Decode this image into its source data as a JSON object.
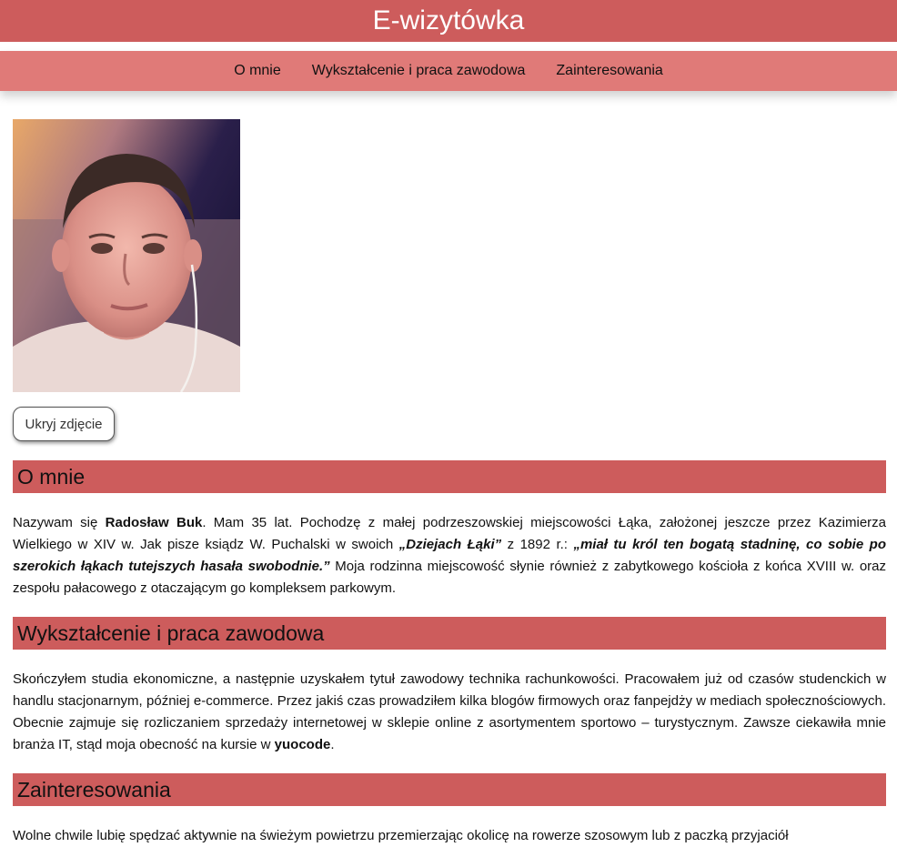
{
  "header": {
    "title": "E-wizytówka"
  },
  "nav": {
    "items": [
      {
        "label": "O mnie"
      },
      {
        "label": "Wykształcenie i praca zawodowa"
      },
      {
        "label": "Zainteresowania"
      }
    ]
  },
  "photo": {
    "button_label": "Ukryj zdjęcie"
  },
  "sections": {
    "about": {
      "heading": "O mnie",
      "p_intro": "Nazywam się ",
      "name": "Radosław Buk",
      "p_mid1": ". Mam 35 lat. Pochodzę z małej podrzeszowskiej miejscowości Łąka, założonej jeszcze przez Kazimierza Wielkiego w XIV w. Jak pisze ksiądz W. Puchalski w swoich ",
      "book": "„Dziejach Łąki”",
      "p_mid2": " z 1892 r.: ",
      "quote": "„miał tu król ten bogatą stadninę, co sobie po szerokich łąkach tutejszych hasała swobodnie.”",
      "p_end": " Moja rodzinna miejscowość słynie również z zabytkowego kościoła z końca XVIII w. oraz zespołu pałacowego z otaczającym go kompleksem parkowym."
    },
    "education": {
      "heading": "Wykształcenie i praca zawodowa",
      "p_text": "Skończyłem studia ekonomiczne, a następnie uzyskałem tytuł zawodowy technika rachunkowości. Pracowałem już od czasów studenckich w handlu stacjonarnym, później e-commerce. Przez jakiś czas prowadziłem kilka blogów firmowych oraz fanpejdży w mediach społecznościowych. Obecnie zajmuje się rozliczaniem sprzedaży internetowej w sklepie online z asortymentem sportowo – turystycznym. Zawsze ciekawiła mnie branża IT, stąd moja obecność na kursie w ",
      "brand": "yuocode",
      "p_end": "."
    },
    "interests": {
      "heading": "Zainteresowania",
      "p_text": "Wolne chwile lubię spędzać aktywnie na świeżym powietrzu przemierzając okolicę na rowerze szosowym lub z paczką przyjaciół"
    }
  },
  "colors": {
    "accent": "#cd5c5c",
    "nav_bg": "#e07a78"
  }
}
